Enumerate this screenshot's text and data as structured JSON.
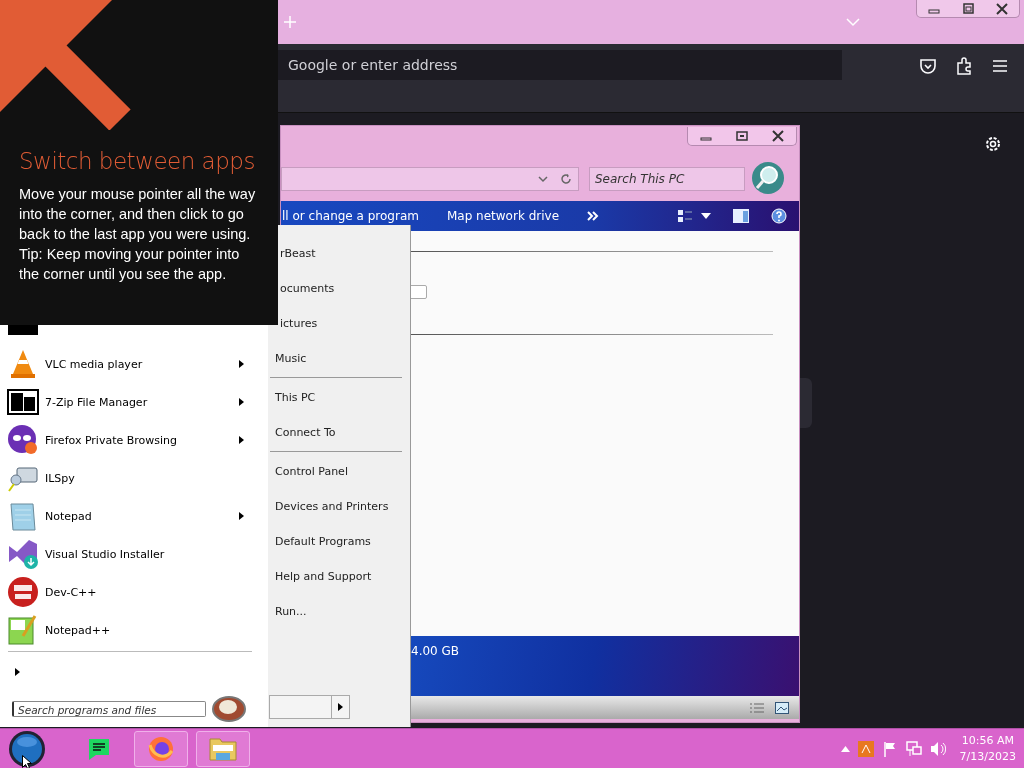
{
  "browser": {
    "address_placeholder": "Google or enter address"
  },
  "explorer": {
    "search_placeholder": "Search This PC",
    "toolbar": [
      "ll or change a program",
      "Map network drive"
    ],
    "capacity": "4.00 GB"
  },
  "start_menu": {
    "programs": [
      {
        "name": "VLC media player",
        "kind": "vlc",
        "submenu": true
      },
      {
        "name": "7-Zip File Manager",
        "kind": "zip",
        "submenu": true
      },
      {
        "name": "Firefox Private Browsing",
        "kind": "private",
        "submenu": true
      },
      {
        "name": "ILSpy",
        "kind": "ilspy",
        "submenu": false
      },
      {
        "name": "Notepad",
        "kind": "notepad",
        "submenu": true
      },
      {
        "name": "Visual Studio Installer",
        "kind": "vs",
        "submenu": false
      },
      {
        "name": "Dev-C++",
        "kind": "dev",
        "submenu": false
      },
      {
        "name": "Notepad++",
        "kind": "npp",
        "submenu": false
      }
    ],
    "search_placeholder": "Search programs and files",
    "places": [
      [
        "rBeast",
        "ocuments",
        "ictures",
        "Music"
      ],
      [
        "This PC",
        "Connect To"
      ],
      [
        "Control Panel",
        "Devices and Printers",
        "Default Programs",
        "Help and Support",
        "Run..."
      ]
    ]
  },
  "tip": {
    "title": "Switch between apps",
    "paragraphs": [
      "Move your mouse pointer all the way into the corner, and then click to go back to the last app you were using.",
      "Tip: Keep moving your pointer into the corner until you see the app."
    ]
  },
  "taskbar": {
    "apps": [
      {
        "kind": "spotify",
        "running": false
      },
      {
        "kind": "firefox",
        "running": true
      },
      {
        "kind": "folder",
        "running": true
      }
    ],
    "time": "10:56 AM",
    "date": "7/13/2023"
  }
}
